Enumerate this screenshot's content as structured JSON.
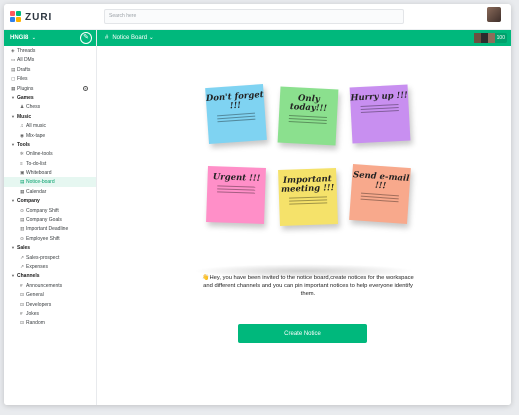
{
  "app": {
    "logo_text": "ZURI",
    "brand_color": "#00b87c"
  },
  "search": {
    "placeholder": "Search here"
  },
  "sidebar": {
    "workspace": "HNGI8",
    "items": [
      {
        "label": "Threads",
        "icon": "threads-icon",
        "glyph": "◈",
        "kind": "item"
      },
      {
        "label": "All DMs",
        "icon": "dm-icon",
        "glyph": "▭",
        "kind": "item"
      },
      {
        "label": "Drafts",
        "icon": "drafts-icon",
        "glyph": "▤",
        "kind": "item"
      },
      {
        "label": "Files",
        "icon": "files-icon",
        "glyph": "▢",
        "kind": "item"
      },
      {
        "label": "Plugins",
        "icon": "plugins-icon",
        "glyph": "▦",
        "kind": "item",
        "plus": true
      },
      {
        "label": "Games",
        "icon": "caret-down-icon",
        "glyph": "▼",
        "kind": "section"
      },
      {
        "label": "Chess",
        "icon": "chess-icon",
        "glyph": "♟",
        "kind": "sub"
      },
      {
        "label": "Music",
        "icon": "caret-down-icon",
        "glyph": "▼",
        "kind": "section"
      },
      {
        "label": "All music",
        "icon": "headphones-icon",
        "glyph": "♫",
        "kind": "sub"
      },
      {
        "label": "Mix-tape",
        "icon": "disc-icon",
        "glyph": "◉",
        "kind": "sub"
      },
      {
        "label": "Tools",
        "icon": "caret-down-icon",
        "glyph": "▼",
        "kind": "section"
      },
      {
        "label": "Online-tools",
        "icon": "tools-icon",
        "glyph": "✲",
        "kind": "sub"
      },
      {
        "label": "To-do-list",
        "icon": "list-icon",
        "glyph": "≡",
        "kind": "sub"
      },
      {
        "label": "Whiteboard",
        "icon": "board-icon",
        "glyph": "▣",
        "kind": "sub"
      },
      {
        "label": "Notice-board",
        "icon": "notice-icon",
        "glyph": "▤",
        "kind": "sub",
        "active": true
      },
      {
        "label": "Calendar",
        "icon": "calendar-icon",
        "glyph": "▦",
        "kind": "sub"
      },
      {
        "label": "Company",
        "icon": "caret-down-icon",
        "glyph": "▼",
        "kind": "section"
      },
      {
        "label": "Company Shift",
        "icon": "shift-icon",
        "glyph": "⊙",
        "kind": "sub"
      },
      {
        "label": "Company Goals",
        "icon": "goals-icon",
        "glyph": "▤",
        "kind": "sub"
      },
      {
        "label": "Important Deadline",
        "icon": "deadline-icon",
        "glyph": "▥",
        "kind": "sub"
      },
      {
        "label": "Employee Shift",
        "icon": "employee-icon",
        "glyph": "⊙",
        "kind": "sub"
      },
      {
        "label": "Sales",
        "icon": "caret-down-icon",
        "glyph": "▼",
        "kind": "section"
      },
      {
        "label": "Sales-prospect",
        "icon": "trend-icon",
        "glyph": "↗",
        "kind": "sub"
      },
      {
        "label": "Expenses",
        "icon": "trend-icon",
        "glyph": "↗",
        "kind": "sub"
      },
      {
        "label": "Channels",
        "icon": "caret-down-icon",
        "glyph": "▼",
        "kind": "section"
      },
      {
        "label": "Announcements",
        "icon": "hash-icon",
        "glyph": "#",
        "kind": "sub"
      },
      {
        "label": "General",
        "icon": "lock-icon",
        "glyph": "⊡",
        "kind": "sub"
      },
      {
        "label": "Developers",
        "icon": "lock-icon",
        "glyph": "⊡",
        "kind": "sub"
      },
      {
        "label": "Jokes",
        "icon": "hash-icon",
        "glyph": "#",
        "kind": "sub"
      },
      {
        "label": "Random",
        "icon": "lock-icon",
        "glyph": "⊡",
        "kind": "sub"
      }
    ]
  },
  "channel": {
    "title": "Notice Board",
    "member_count": "100"
  },
  "notes": [
    {
      "text": "Don't forget !!!",
      "color": "#7fd3f2"
    },
    {
      "text": "Only today!!!",
      "color": "#8be08e"
    },
    {
      "text": "Hurry up !!!",
      "color": "#c88ff0"
    },
    {
      "text": "Urgent !!!",
      "color": "#ff8fc8"
    },
    {
      "text": "Important meeting !!!",
      "color": "#f5e26a"
    },
    {
      "text": "Send e-mail !!!",
      "color": "#f8a98c"
    }
  ],
  "main": {
    "message": "👋Hey, you have been invited to the notice board,create notices for the workspace and different channels and you can pin important notices to help everyone identify them.",
    "cta_label": "Create Notice"
  }
}
